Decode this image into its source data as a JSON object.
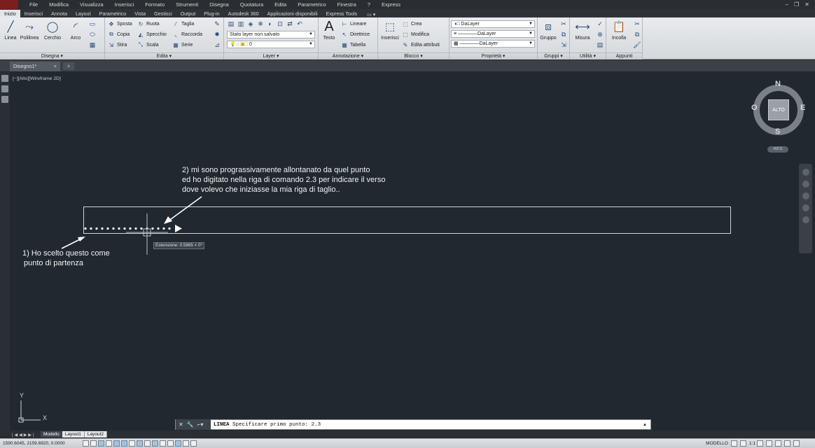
{
  "menu": {
    "items": [
      "File",
      "Modifica",
      "Visualizza",
      "Inserisci",
      "Formato",
      "Strumenti",
      "Disegna",
      "Quotatura",
      "Edita",
      "Parametrico",
      "Finestra",
      "?",
      "Express"
    ]
  },
  "ribbon_tabs": [
    "Inizio",
    "Inserisci",
    "Annota",
    "Layout",
    "Parametrico",
    "Vista",
    "Gestisci",
    "Output",
    "Plug-in",
    "Autodesk 360",
    "Applicazioni disponibili",
    "Express Tools"
  ],
  "ribbon": {
    "disegna": {
      "title": "Disegna ▾",
      "linea": "Linea",
      "polilinea": "Polilinea",
      "cerchio": "Cerchio",
      "arco": "Arco"
    },
    "edita": {
      "title": "Edita ▾",
      "sposta": "Sposta",
      "ruota": "Ruota",
      "taglia": "Taglia",
      "copia": "Copia",
      "specchio": "Specchio",
      "raccorda": "Raccorda",
      "stira": "Stira",
      "scala": "Scala",
      "serie": "Serie"
    },
    "layer": {
      "title": "Layer ▾",
      "stato": "Stato layer non salvato",
      "current": "0"
    },
    "annotazione": {
      "title": "Annotazione ▾",
      "testo": "Testo",
      "lineare": "Lineare",
      "direttrice": "Direttrice",
      "tabella": "Tabella"
    },
    "blocco": {
      "title": "Blocco ▾",
      "inserisci": "Inserisci",
      "crea": "Crea",
      "modifica": "Modifica",
      "edita_attributi": "Edita attributi"
    },
    "proprieta": {
      "title": "Proprietà ▾",
      "colore": "DaLayer",
      "tipolinea": "DaLayer",
      "spessore": "DaLayer"
    },
    "gruppi": {
      "title": "Gruppi ▾",
      "gruppo": "Gruppo"
    },
    "utilita": {
      "title": "Utilità ▾",
      "misura": "Misura"
    },
    "appunti": {
      "title": "Appunti",
      "incolla": "Incolla"
    }
  },
  "document": {
    "tab": "Disegno1*",
    "viewport_label": "[−][Alto][Wireframe 2D]"
  },
  "annotations": {
    "note2": [
      "2) mi sono prograssivamente allontanato da quel punto",
      "ed ho digitato nella riga di comando 2.3 per indicare il verso",
      "dove volevo che iniziasse la mia riga di taglio.."
    ],
    "note1": [
      "1) Ho scelto questo come",
      "punto di partenza"
    ]
  },
  "tooltip": "Estensione: 0.5865 < 0°",
  "viewcube": {
    "n": "N",
    "s": "S",
    "e": "E",
    "o": "O",
    "face": "ALTO",
    "wcs": "WCS"
  },
  "ucs": {
    "x": "X",
    "y": "Y"
  },
  "command": {
    "name": "LINEA",
    "prompt": "Specificare primo punto:",
    "input": "2.3"
  },
  "layout_tabs": [
    "Modello",
    "Layout1",
    "Layout2"
  ],
  "status": {
    "coords": "1590.6045, 2159.6920, 0.0000",
    "model": "MODELLO",
    "scale": "1:1"
  },
  "colors": {
    "canvas_bg": "#212830",
    "ribbon_bg": "#e1e3e6",
    "accent": "#9cc4ea"
  }
}
